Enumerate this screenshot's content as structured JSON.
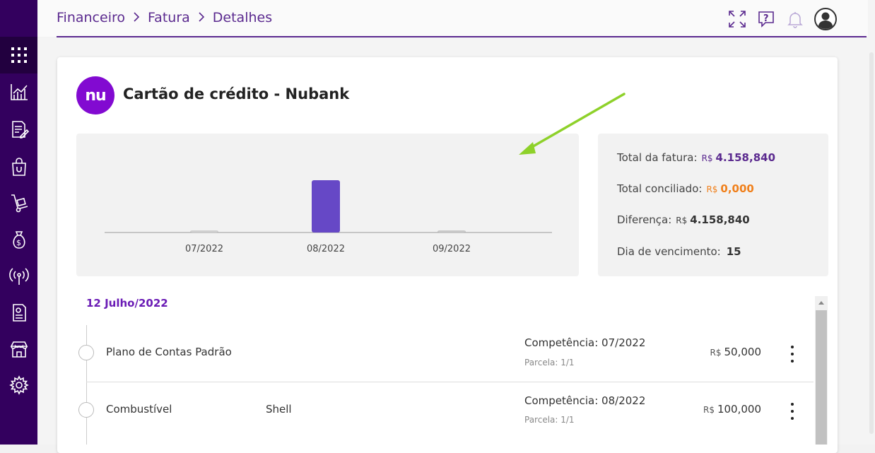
{
  "breadcrumb": [
    "Financeiro",
    "Fatura",
    "Detalhes"
  ],
  "header_icons": [
    "expand-icon",
    "help-icon",
    "bell-icon",
    "user-avatar-icon"
  ],
  "sidebar_icons": [
    "grid-icon",
    "chart-icon",
    "document-edit-icon",
    "shopping-bag-icon",
    "hand-truck-icon",
    "money-bag-icon",
    "signal-icon",
    "receipt-icon",
    "store-icon",
    "settings-icon"
  ],
  "card": {
    "logo_text": "nu",
    "title": "Cartão de crédito - Nubank"
  },
  "chart_data": {
    "type": "bar",
    "categories": [
      "07/2022",
      "08/2022",
      "09/2022"
    ],
    "values": [
      0.0,
      4158.84,
      0.0
    ],
    "colors": [
      "#cfcfcf",
      "#6648c6",
      "#c8c8c8"
    ],
    "highlight": "08/2022"
  },
  "summary": {
    "currency": "R$",
    "total_label": "Total da fatura:",
    "total_value": "4.158,840",
    "reconciled_label": "Total conciliado:",
    "reconciled_value": "0,000",
    "difference_label": "Diferença:",
    "difference_value": "4.158,840",
    "due_label": "Dia de vencimento:",
    "due_value": "15"
  },
  "colors": {
    "sidebar": "#33005e",
    "accent": "#5b2a8f",
    "total_value": "#5b2a8f",
    "reconciled_value": "#f0801c",
    "annotation_arrow": "#8ed12a"
  },
  "transactions": {
    "month_heading": "12 Julho/2022",
    "entries": [
      {
        "category": "Plano de Contas Padrão",
        "merchant": "",
        "competence": "Competência: 07/2022",
        "installment": "Parcela: 1/1",
        "currency": "R$",
        "amount": "50,000"
      },
      {
        "category": "Combustível",
        "merchant": "Shell",
        "competence": "Competência: 08/2022",
        "installment": "Parcela: 1/1",
        "currency": "R$",
        "amount": "100,000"
      }
    ]
  }
}
